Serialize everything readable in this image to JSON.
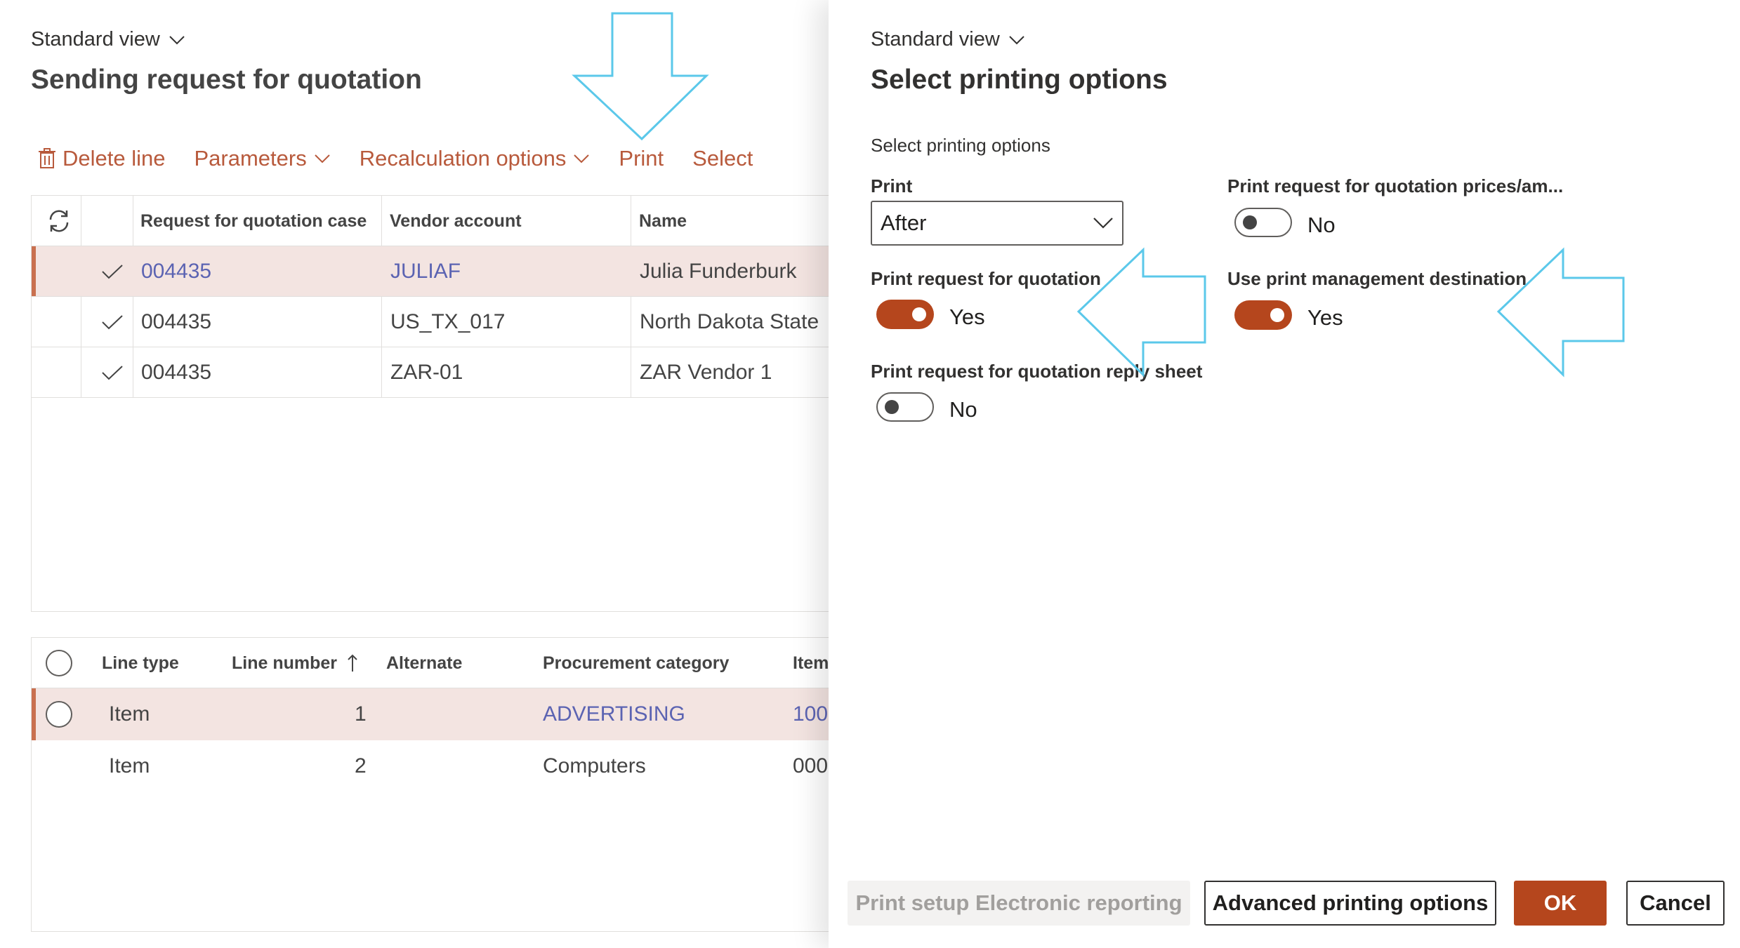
{
  "left_page": {
    "view_label": "Standard view",
    "title": "Sending request for quotation",
    "actions": {
      "delete_line": "Delete line",
      "parameters": "Parameters",
      "recalculation_options": "Recalculation options",
      "print": "Print",
      "select": "Select"
    },
    "quotation_grid": {
      "headers": [
        "Request for quotation case",
        "Vendor account",
        "Name"
      ],
      "rows": [
        {
          "case": "004435",
          "vendor": "JULIAF",
          "name": "Julia Funderburk"
        },
        {
          "case": "004435",
          "vendor": "US_TX_017",
          "name": "North Dakota State"
        },
        {
          "case": "004435",
          "vendor": "ZAR-01",
          "name": "ZAR Vendor 1"
        }
      ]
    },
    "lines_grid": {
      "headers": [
        "Line type",
        "Line number",
        "Alternate",
        "Procurement category",
        "Item"
      ],
      "rows": [
        {
          "line_type": "Item",
          "line_number": "1",
          "alternate": "",
          "category": "ADVERTISING",
          "item": "100"
        },
        {
          "line_type": "Item",
          "line_number": "2",
          "alternate": "",
          "category": "Computers",
          "item": "000"
        }
      ]
    }
  },
  "dialog": {
    "view_label": "Standard view",
    "title": "Select printing options",
    "group_title": "Select printing options",
    "print_label": "Print",
    "print_value": "After",
    "print_rfq_label": "Print request for quotation",
    "print_rfq_value": "Yes",
    "print_reply_sheet_label": "Print request for quotation reply sheet",
    "print_reply_sheet_value": "No",
    "print_prices_label": "Print request for quotation prices/am...",
    "print_prices_value": "No",
    "use_print_mgmt_label": "Use print management destination",
    "use_print_mgmt_value": "Yes",
    "buttons": {
      "print_setup_er": "Print setup Electronic reporting",
      "advanced": "Advanced printing options",
      "ok": "OK",
      "cancel": "Cancel"
    }
  },
  "colors": {
    "accent": "#b5461d",
    "link": "#5b63b2",
    "action_text": "#b85a3c",
    "selected_row": "#f3e4e1",
    "annotation_arrow": "#5bc8ea"
  }
}
